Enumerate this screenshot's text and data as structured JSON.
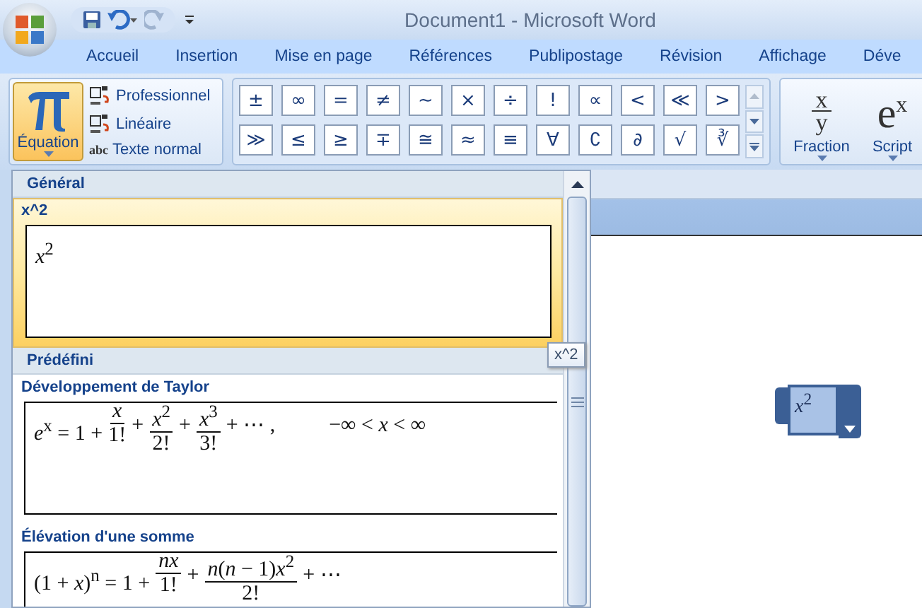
{
  "window": {
    "title": "Document1 - Microsoft Word"
  },
  "tabs": [
    "Accueil",
    "Insertion",
    "Mise en page",
    "Références",
    "Publipostage",
    "Révision",
    "Affichage",
    "Déve"
  ],
  "equation_button": {
    "label": "Équation",
    "open": true
  },
  "equation_modes": [
    {
      "label": "Professionnel"
    },
    {
      "label": "Linéaire"
    },
    {
      "icon_text": "abc",
      "label": "Texte normal"
    }
  ],
  "symbols": [
    [
      "±",
      "∞",
      "=",
      "≠",
      "~",
      "×",
      "÷",
      "!",
      "∝",
      "<",
      "≪",
      ">"
    ],
    [
      "≫",
      "≤",
      "≥",
      "∓",
      "≅",
      "≈",
      "≡",
      "∀",
      "∁",
      "∂",
      "√",
      "∛"
    ]
  ],
  "structures": [
    {
      "kind": "fraction",
      "top": "x",
      "bottom": "y",
      "label": "Fraction"
    },
    {
      "kind": "script",
      "glyph": "e$^{x}$",
      "label": "Script"
    }
  ],
  "gallery": [
    {
      "heading": "Général",
      "items": [
        {
          "name": "x^2",
          "selected": true,
          "formula": [
            {
              "kind": "text",
              "text": "*x*$^{2}$"
            }
          ]
        }
      ]
    },
    {
      "heading": "Prédéfini",
      "items": [
        {
          "name": "Développement de Taylor",
          "selected": false,
          "formula": [
            {
              "kind": "text",
              "text": "*e*$^{x}$ = 1 +"
            },
            {
              "kind": "frac",
              "num": "*x*",
              "den": "1!"
            },
            {
              "kind": "text",
              "text": "+"
            },
            {
              "kind": "frac",
              "num": "*x*$^{2}$",
              "den": "2!"
            },
            {
              "kind": "text",
              "text": "+"
            },
            {
              "kind": "frac",
              "num": "*x*$^{3}$",
              "den": "3!"
            },
            {
              "kind": "text",
              "text": "+ ⋯ ,"
            },
            {
              "kind": "gap"
            },
            {
              "kind": "text",
              "text": "−∞ < *x* < ∞"
            }
          ]
        },
        {
          "name": "Élévation d'une somme",
          "selected": false,
          "formula": [
            {
              "kind": "text",
              "text": "(1 + *x*)$^{n}$ = 1 +"
            },
            {
              "kind": "frac",
              "num": "*nx*",
              "den": "1!"
            },
            {
              "kind": "text",
              "text": "+"
            },
            {
              "kind": "frac",
              "num": "*n*(*n* − 1)*x*$^{2}$",
              "den": "2!"
            },
            {
              "kind": "text",
              "text": "+ ⋯"
            }
          ]
        }
      ]
    }
  ],
  "tooltip": "x^2",
  "document_equation": "*x*$^{2}$"
}
